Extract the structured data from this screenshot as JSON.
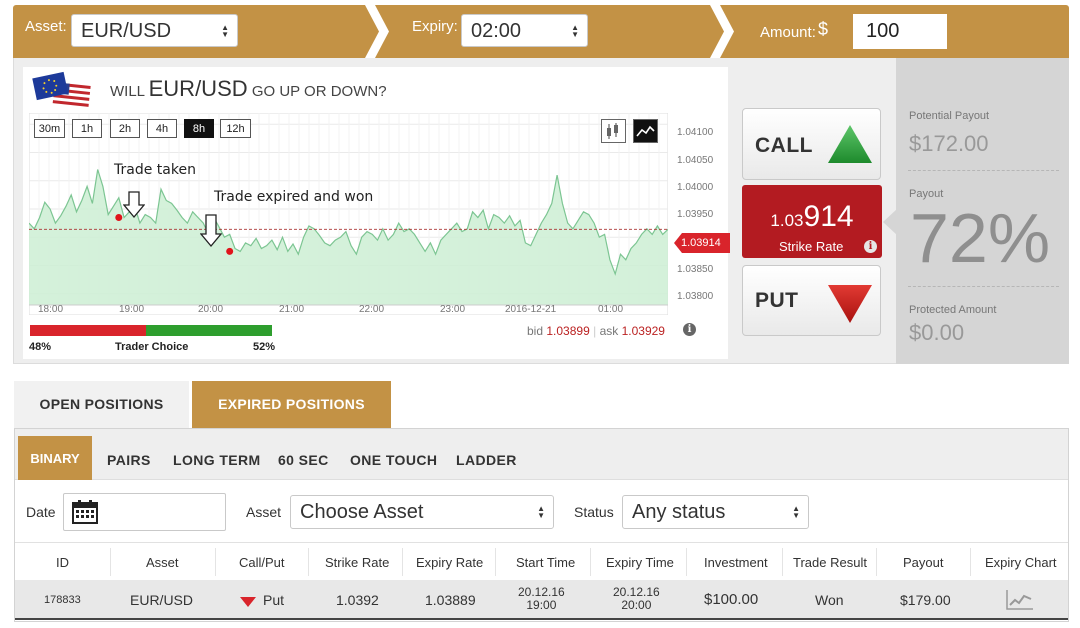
{
  "topbar": {
    "asset_label": "Asset:",
    "asset_value": "EUR/USD",
    "expiry_label": "Expiry:",
    "expiry_value": "02:00",
    "amount_label": "Amount:",
    "currency_symbol": "$",
    "amount_value": "100"
  },
  "question": {
    "prefix": "WILL",
    "pair": "EUR/USD",
    "suffix": "GO UP OR DOWN?"
  },
  "timeframes": [
    "30m",
    "1h",
    "2h",
    "4h",
    "8h",
    "12h"
  ],
  "active_timeframe": "8h",
  "chart_icons": [
    "candlestick-chart-icon",
    "line-chart-icon"
  ],
  "chart_data": {
    "type": "area",
    "x_tick_labels": [
      "18:00",
      "19:00",
      "20:00",
      "21:00",
      "22:00",
      "23:00",
      "2016-12-21",
      "01:00"
    ],
    "y_tick_labels": [
      "1.04100",
      "1.04050",
      "1.04000",
      "1.03950",
      "1.03900",
      "1.03850",
      "1.03800"
    ],
    "ylim": [
      1.0378,
      1.0412
    ],
    "current_price_label": "1.03914",
    "current_price": 1.03914,
    "series": [
      {
        "values": [
          1.03925,
          1.03915,
          1.03935,
          1.03962,
          1.0395,
          1.03925,
          1.03938,
          1.03955,
          1.03975,
          1.03945,
          1.03965,
          1.0399,
          1.0396,
          1.0402,
          1.0399,
          1.0394,
          1.03955,
          1.0397,
          1.03935,
          1.03945,
          1.03955,
          1.03925,
          1.0394,
          1.03935,
          1.03925,
          1.03985,
          1.03965,
          1.0396,
          1.03948,
          1.03935,
          1.03925,
          1.03945,
          1.03935,
          1.03925,
          1.03905,
          1.03935,
          1.03918,
          1.039,
          1.03905,
          1.0388,
          1.03875,
          1.0389,
          1.03885,
          1.03898,
          1.0388,
          1.03885,
          1.03895,
          1.03878,
          1.039,
          1.03875,
          1.03888,
          1.0387,
          1.039,
          1.0392,
          1.03915,
          1.03903,
          1.0389,
          1.03885,
          1.03895,
          1.039,
          1.0391,
          1.03885,
          1.0387,
          1.039,
          1.0391,
          1.03905,
          1.03895,
          1.03915,
          1.03895,
          1.03905,
          1.03925,
          1.0391,
          1.03915,
          1.03905,
          1.0389,
          1.03875,
          1.0389,
          1.0387,
          1.03895,
          1.03905,
          1.03915,
          1.03925,
          1.0391,
          1.03915,
          1.03945,
          1.03935,
          1.03948,
          1.03915,
          1.0394,
          1.03935,
          1.03925,
          1.03938,
          1.0392,
          1.0393,
          1.0389,
          1.03885,
          1.03905,
          1.03925,
          1.0394,
          1.0396,
          1.0401,
          1.0396,
          1.03925,
          1.03915,
          1.0393,
          1.03945,
          1.0394,
          1.03925,
          1.039,
          1.03905,
          1.0386,
          1.03835,
          1.0387,
          1.0386,
          1.0388,
          1.0389,
          1.03905,
          1.03915,
          1.03905,
          1.0392,
          1.03905,
          1.03914
        ]
      }
    ],
    "markers": [
      {
        "x_index": 17,
        "value": 1.03935,
        "label": "Trade taken"
      },
      {
        "x_index": 38,
        "value": 1.03875,
        "label": "Trade expired and won"
      }
    ]
  },
  "bid_ask": {
    "bid_label": "bid",
    "bid_value": "1.03899",
    "ask_label": "ask",
    "ask_value": "1.03929",
    "info_glyph": "i"
  },
  "trader_choice": {
    "put_pct_label": "48%",
    "label": "Trader Choice",
    "call_pct_label": "52%",
    "put_pct": 48,
    "call_pct": 52,
    "put_color": "#d9242b",
    "call_color": "#2e9e2e"
  },
  "call": {
    "label": "CALL",
    "arrow_color": "#2a9a3a"
  },
  "put": {
    "label": "PUT",
    "arrow_color": "#c71a1a"
  },
  "strike": {
    "rate_prefix": "1.03",
    "rate_suffix": "914",
    "label": "Strike Rate",
    "info_glyph": "i",
    "bg_color": "#b31b21"
  },
  "payout_panel": {
    "potential_label": "Potential Payout",
    "potential_value": "$172.00",
    "payout_label": "Payout",
    "payout_pct": "72%",
    "protected_label": "Protected Amount",
    "protected_value": "$0.00"
  },
  "positions": {
    "tabs": [
      "OPEN POSITIONS",
      "EXPIRED POSITIONS"
    ],
    "active_tab": "EXPIRED POSITIONS",
    "subtabs": [
      "BINARY",
      "PAIRS",
      "LONG TERM",
      "60 SEC",
      "ONE TOUCH",
      "LADDER"
    ],
    "active_subtab": "BINARY",
    "filters": {
      "date_label": "Date",
      "asset_label": "Asset",
      "asset_value": "Choose Asset",
      "status_label": "Status",
      "status_value": "Any status"
    },
    "columns": [
      "ID",
      "Asset",
      "Call/Put",
      "Strike Rate",
      "Expiry Rate",
      "Start Time",
      "Expiry Time",
      "Investment",
      "Trade Result",
      "Payout",
      "Expiry Chart"
    ],
    "rows": [
      {
        "id": "178833",
        "asset": "EUR/USD",
        "direction": "Put",
        "strike_rate": "1.0392",
        "expiry_rate": "1.03889",
        "start_date": "20.12.16",
        "start_time": "19:00",
        "expiry_date": "20.12.16",
        "expiry_time": "20:00",
        "investment": "$100.00",
        "result": "Won",
        "payout": "$179.00",
        "chart_icon": "line-chart-icon"
      }
    ]
  },
  "accent_color": "#c39245"
}
